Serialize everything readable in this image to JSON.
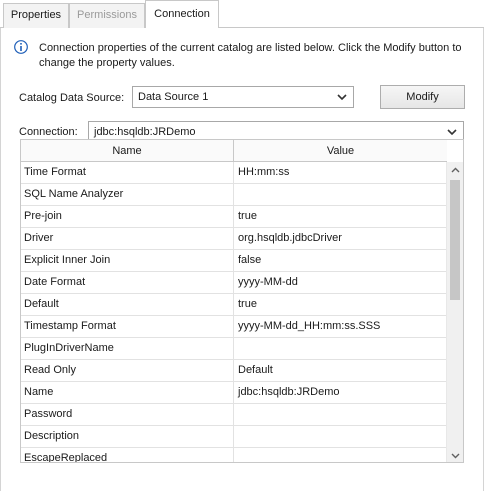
{
  "tabs": [
    {
      "label": "Properties",
      "state": "normal"
    },
    {
      "label": "Permissions",
      "state": "disabled"
    },
    {
      "label": "Connection",
      "state": "active"
    }
  ],
  "info": {
    "icon": "info-icon",
    "text": "Connection properties of the current catalog are listed below. Click the Modify button to change the property values."
  },
  "catalog_source": {
    "label": "Catalog Data Source:",
    "value": "Data Source 1"
  },
  "modify_button": "Modify",
  "connection": {
    "label": "Connection:",
    "value": "jdbc:hsqldb:JRDemo"
  },
  "table": {
    "columns": [
      "Name",
      "Value"
    ],
    "rows": [
      {
        "name": "Time Format",
        "value": "HH:mm:ss"
      },
      {
        "name": "SQL Name Analyzer",
        "value": ""
      },
      {
        "name": "Pre-join",
        "value": "true"
      },
      {
        "name": "Driver",
        "value": "org.hsqldb.jdbcDriver"
      },
      {
        "name": "Explicit Inner Join",
        "value": "false"
      },
      {
        "name": "Date Format",
        "value": "yyyy-MM-dd"
      },
      {
        "name": "Default",
        "value": "true"
      },
      {
        "name": "Timestamp Format",
        "value": "yyyy-MM-dd_HH:mm:ss.SSS"
      },
      {
        "name": "PlugInDriverName",
        "value": ""
      },
      {
        "name": "Read Only",
        "value": "Default"
      },
      {
        "name": "Name",
        "value": "jdbc:hsqldb:JRDemo"
      },
      {
        "name": "Password",
        "value": ""
      },
      {
        "name": "Description",
        "value": ""
      },
      {
        "name": "EscapeReplaced",
        "value": ""
      }
    ]
  }
}
